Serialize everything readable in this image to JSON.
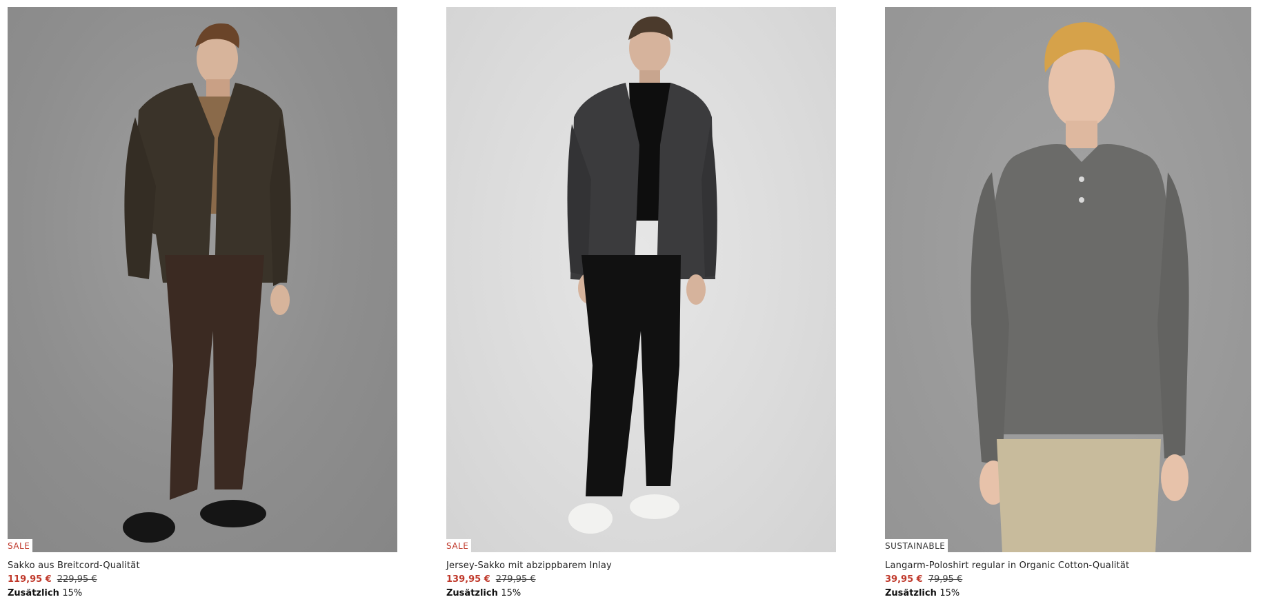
{
  "products": [
    {
      "badge": "SALE",
      "name": "Sakko aus Breitcord-Qualität",
      "price": "119,95 €",
      "old_price": "229,95 €",
      "extra_label": "Zusätzlich",
      "extra_value": "15%",
      "colors": {
        "jacket": "#3a3329",
        "pants": "#3b2a22",
        "top": "#8a6a4a",
        "shoes": "#151515",
        "skin": "#d7b49b",
        "hair": "#6a4429"
      }
    },
    {
      "badge": "SALE",
      "name": "Jersey-Sakko mit abzippbarem Inlay",
      "price": "139,95 €",
      "old_price": "279,95 €",
      "extra_label": "Zusätzlich",
      "extra_value": "15%",
      "colors": {
        "jacket": "#3b3b3d",
        "pants": "#111111",
        "top": "#0e0e0e",
        "shoes": "#f2f2f0",
        "skin": "#d6b39c",
        "hair": "#4b3a2c"
      }
    },
    {
      "badge": "SUSTAINABLE",
      "name": "Langarm-Poloshirt regular in Organic Cotton-Qualität",
      "price": "39,95 €",
      "old_price": "79,95 €",
      "extra_label": "Zusätzlich",
      "extra_value": "15%",
      "colors": {
        "jacket": "#6b6b69",
        "pants": "#c8bb9c",
        "skin": "#e7c2aa",
        "hair": "#d6a24a"
      }
    }
  ],
  "theme": {
    "sale_color": "#c0392b"
  }
}
